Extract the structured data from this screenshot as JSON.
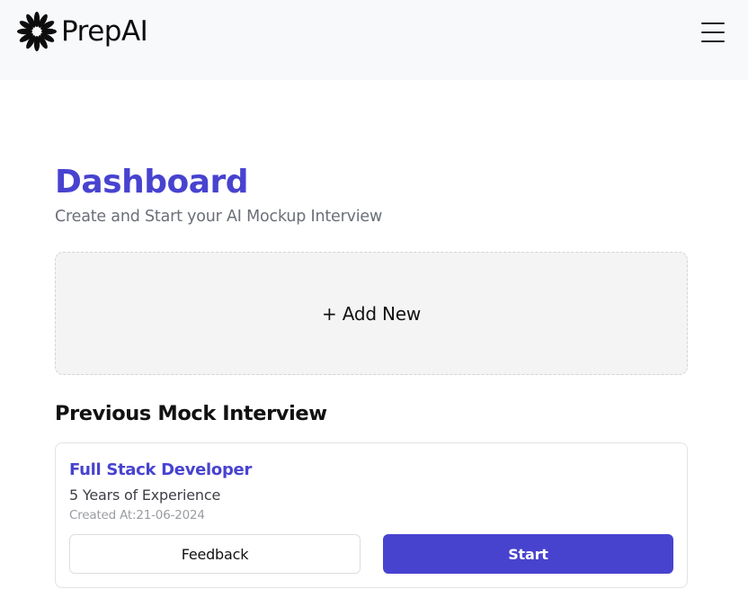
{
  "header": {
    "logo_text": "PrepAI",
    "logo_icon": "sunburst-logo-icon",
    "menu_icon": "hamburger-menu-icon"
  },
  "dashboard": {
    "title": "Dashboard",
    "subtitle": "Create and Start your AI Mockup Interview",
    "add_new_label": "+ Add New"
  },
  "previous": {
    "section_title": "Previous Mock Interview",
    "interviews": [
      {
        "role": "Full Stack Developer",
        "experience": "5 Years of Experience",
        "created": "Created At:21-06-2024",
        "feedback_label": "Feedback",
        "start_label": "Start"
      }
    ]
  },
  "colors": {
    "accent": "#4843cf",
    "header_bg": "#f8f9fb",
    "add_new_bg": "#f4f4f5"
  }
}
